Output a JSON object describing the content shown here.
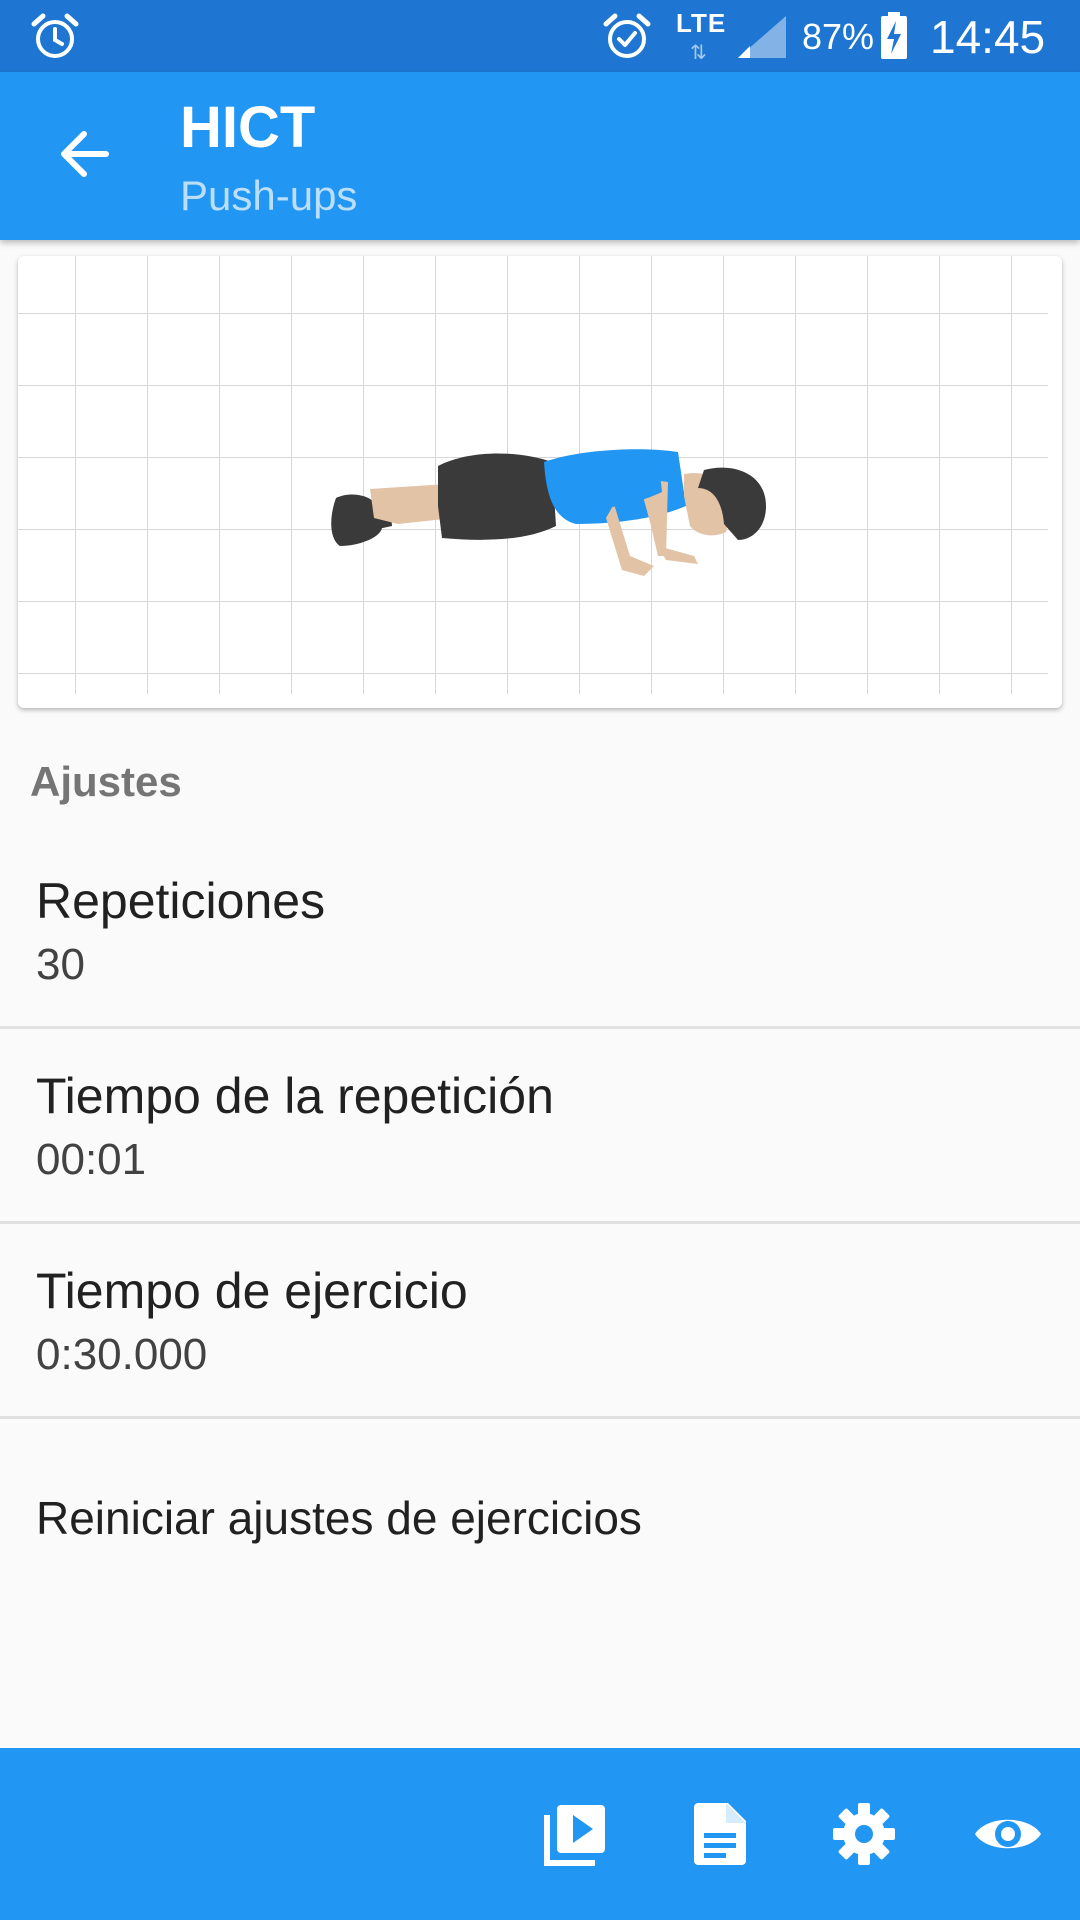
{
  "status_bar": {
    "battery_percent": "87%",
    "network_type": "LTE",
    "time": "14:45",
    "icons": [
      "alarm-icon",
      "alarm-icon",
      "lte-icon",
      "signal-icon",
      "battery-charging-icon"
    ]
  },
  "app_bar": {
    "title": "HICT",
    "subtitle": "Push-ups",
    "back_icon": "arrow-back-icon"
  },
  "exercise_image": {
    "description_icon": "push-up-figure"
  },
  "settings": {
    "section_header": "Ajustes",
    "items": [
      {
        "title": "Repeticiones",
        "value": "30"
      },
      {
        "title": "Tiempo de la repetición",
        "value": "00:01"
      },
      {
        "title": "Tiempo de ejercicio",
        "value": "0:30.000"
      }
    ],
    "reset_label": "Reiniciar ajustes de ejercicios"
  },
  "bottom_bar": {
    "actions": [
      "video-library-icon",
      "description-icon",
      "settings-gear-icon",
      "visibility-eye-icon"
    ]
  },
  "colors": {
    "status_bar": "#1e76d2",
    "primary": "#2196f3",
    "subtitle": "#bbdefb",
    "section_header": "#757575",
    "background": "#fafafa"
  }
}
